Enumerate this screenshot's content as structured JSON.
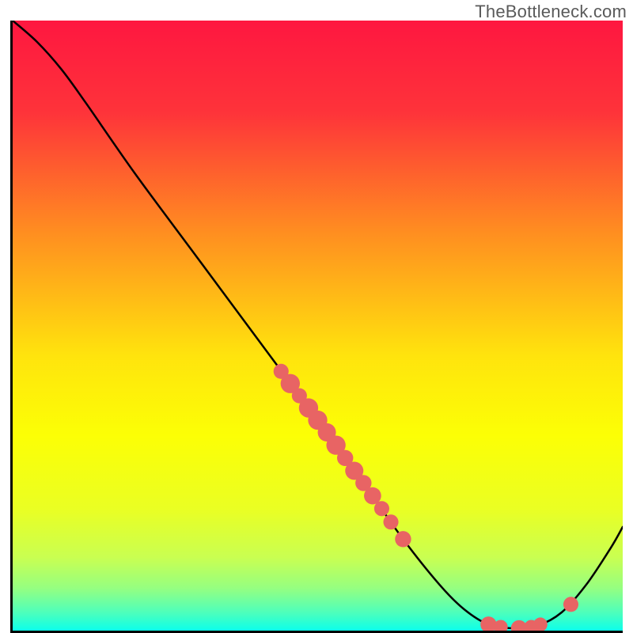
{
  "attribution": "TheBottleneck.com",
  "chart_data": {
    "type": "line",
    "title": "",
    "xlabel": "",
    "ylabel": "",
    "xlim": [
      0,
      100
    ],
    "ylim": [
      0,
      100
    ],
    "gradient_stops": [
      {
        "offset": 0.0,
        "color": "#fe1740"
      },
      {
        "offset": 0.15,
        "color": "#fe333a"
      },
      {
        "offset": 0.35,
        "color": "#ff8f20"
      },
      {
        "offset": 0.55,
        "color": "#ffe40d"
      },
      {
        "offset": 0.68,
        "color": "#fcff05"
      },
      {
        "offset": 0.8,
        "color": "#eaff23"
      },
      {
        "offset": 0.88,
        "color": "#c9ff51"
      },
      {
        "offset": 0.93,
        "color": "#96ff80"
      },
      {
        "offset": 0.97,
        "color": "#4effbb"
      },
      {
        "offset": 1.0,
        "color": "#0cffea"
      }
    ],
    "curve": [
      {
        "x": 0.0,
        "y": 100.0
      },
      {
        "x": 4.0,
        "y": 96.5
      },
      {
        "x": 8.0,
        "y": 92.0
      },
      {
        "x": 12.0,
        "y": 86.5
      },
      {
        "x": 20.0,
        "y": 75.0
      },
      {
        "x": 30.0,
        "y": 61.5
      },
      {
        "x": 40.0,
        "y": 48.0
      },
      {
        "x": 50.0,
        "y": 34.5
      },
      {
        "x": 58.0,
        "y": 23.5
      },
      {
        "x": 64.0,
        "y": 15.0
      },
      {
        "x": 70.0,
        "y": 7.5
      },
      {
        "x": 74.0,
        "y": 3.5
      },
      {
        "x": 78.0,
        "y": 1.0
      },
      {
        "x": 82.0,
        "y": 0.4
      },
      {
        "x": 86.0,
        "y": 0.8
      },
      {
        "x": 90.0,
        "y": 3.0
      },
      {
        "x": 94.0,
        "y": 7.5
      },
      {
        "x": 98.0,
        "y": 13.5
      },
      {
        "x": 100.0,
        "y": 17.0
      }
    ],
    "markers": [
      {
        "x": 44.0,
        "y": 42.5,
        "r": 1.0
      },
      {
        "x": 45.5,
        "y": 40.5,
        "r": 1.4
      },
      {
        "x": 47.0,
        "y": 38.5,
        "r": 1.0
      },
      {
        "x": 48.5,
        "y": 36.5,
        "r": 1.4
      },
      {
        "x": 50.0,
        "y": 34.5,
        "r": 1.4
      },
      {
        "x": 51.5,
        "y": 32.5,
        "r": 1.3
      },
      {
        "x": 53.0,
        "y": 30.4,
        "r": 1.4
      },
      {
        "x": 54.5,
        "y": 28.3,
        "r": 1.1
      },
      {
        "x": 56.0,
        "y": 26.2,
        "r": 1.3
      },
      {
        "x": 57.5,
        "y": 24.2,
        "r": 1.1
      },
      {
        "x": 59.0,
        "y": 22.1,
        "r": 1.2
      },
      {
        "x": 60.5,
        "y": 20.0,
        "r": 1.0
      },
      {
        "x": 62.0,
        "y": 17.8,
        "r": 1.0
      },
      {
        "x": 64.0,
        "y": 15.0,
        "r": 1.1
      },
      {
        "x": 78.0,
        "y": 1.0,
        "r": 1.1
      },
      {
        "x": 80.0,
        "y": 0.6,
        "r": 0.9
      },
      {
        "x": 83.0,
        "y": 0.4,
        "r": 1.1
      },
      {
        "x": 85.0,
        "y": 0.6,
        "r": 0.9
      },
      {
        "x": 86.5,
        "y": 1.0,
        "r": 0.9
      },
      {
        "x": 91.5,
        "y": 4.3,
        "r": 1.0
      }
    ],
    "marker_color": "#e86464",
    "line_color": "#000000"
  }
}
